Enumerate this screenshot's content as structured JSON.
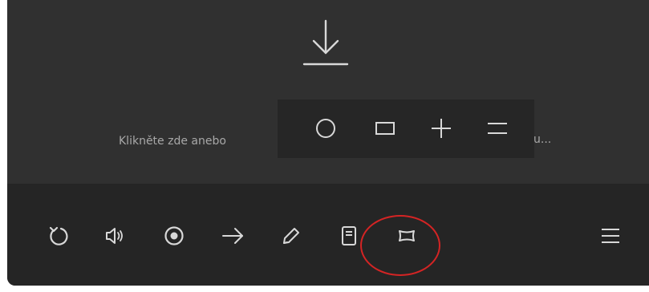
{
  "drop_area": {
    "hint_text": "Klikněte zde anebo",
    "hint_text_tail": "u..."
  },
  "shape_popup": {
    "items": [
      {
        "icon": "circle-icon"
      },
      {
        "icon": "rectangle-icon"
      },
      {
        "icon": "plus-icon"
      },
      {
        "icon": "equals-icon"
      }
    ]
  },
  "toolbar": {
    "items": [
      {
        "icon": "refresh-icon"
      },
      {
        "icon": "speaker-icon"
      },
      {
        "icon": "record-icon"
      },
      {
        "icon": "arrow-right-icon"
      },
      {
        "icon": "pencil-icon"
      },
      {
        "icon": "document-icon"
      },
      {
        "icon": "shape-tool-icon"
      },
      {
        "icon": "menu-icon"
      }
    ]
  },
  "colors": {
    "icon": "#d8d8d8",
    "highlight": "#d42424"
  }
}
